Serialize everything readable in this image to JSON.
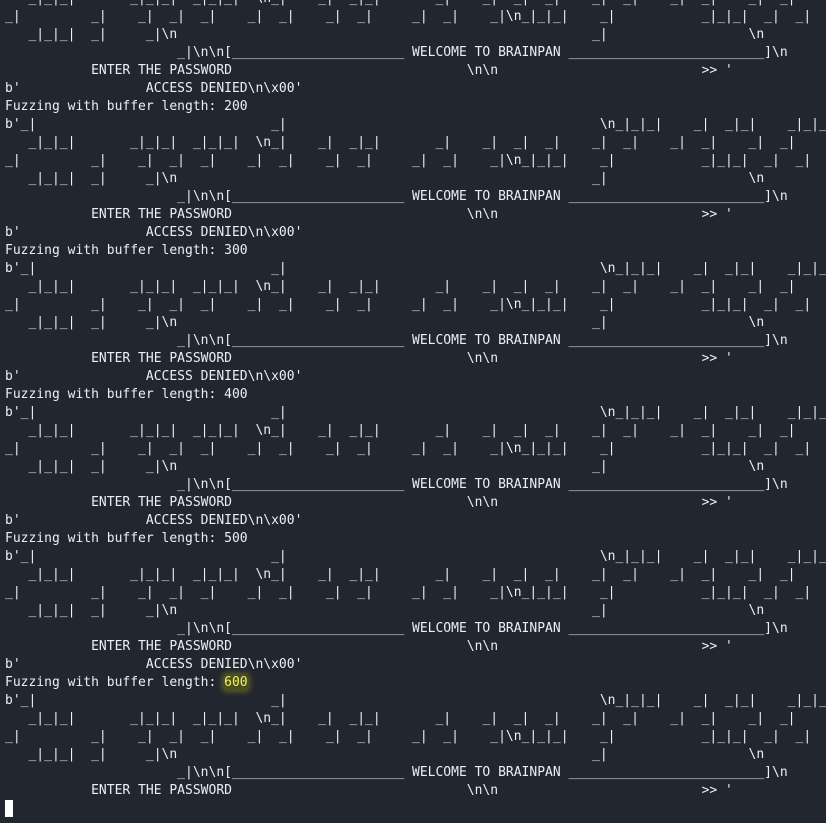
{
  "terminal": {
    "lines": [
      {
        "text": "   _|_|_|       _|_|_|  _|_|_|  \\n_|    _|  _|_|       _|    _|  _|  _|    _|  _|    _|  _|    _|  _|",
        "pre": "",
        "hl": "",
        "post": ""
      },
      {
        "text": "_|         _|    _|  _|  _|    _|  _|    _|  _|     _|  _|    _|\\n_|_|_|    _|           _|_|_|  _|  _|",
        "pre": "",
        "hl": "",
        "post": ""
      },
      {
        "text": "   _|_|_|  _|     _|\\n                                                     _|                  \\n",
        "pre": "",
        "hl": "",
        "post": ""
      },
      {
        "text": "                      _|\\n\\n[______________________ WELCOME TO BRAINPAN _________________________]\\n",
        "pre": "",
        "hl": "",
        "post": ""
      },
      {
        "text": "           ENTER THE PASSWORD                              \\n\\n                          >> '",
        "pre": "",
        "hl": "",
        "post": ""
      },
      {
        "text": "b'                ACCESS DENIED\\n\\x00'",
        "pre": "",
        "hl": "",
        "post": ""
      },
      {
        "text": "Fuzzing with buffer length: 200",
        "pre": "",
        "hl": "",
        "post": ""
      },
      {
        "text": "b'_|                              _|                                        \\n_|_|_|    _|  _|_|    _|_|_",
        "pre": "",
        "hl": "",
        "post": ""
      },
      {
        "text": "   _|_|_|       _|_|_|  _|_|_|  \\n_|    _|  _|_|       _|    _|  _|  _|    _|  _|    _|  _|    _|  _|",
        "pre": "",
        "hl": "",
        "post": ""
      },
      {
        "text": "_|         _|    _|  _|  _|    _|  _|    _|  _|     _|  _|    _|\\n_|_|_|    _|           _|_|_|  _|  _|",
        "pre": "",
        "hl": "",
        "post": ""
      },
      {
        "text": "   _|_|_|  _|     _|\\n                                                     _|                  \\n",
        "pre": "",
        "hl": "",
        "post": ""
      },
      {
        "text": "                      _|\\n\\n[______________________ WELCOME TO BRAINPAN _________________________]\\n",
        "pre": "",
        "hl": "",
        "post": ""
      },
      {
        "text": "           ENTER THE PASSWORD                              \\n\\n                          >> '",
        "pre": "",
        "hl": "",
        "post": ""
      },
      {
        "text": "b'                ACCESS DENIED\\n\\x00'",
        "pre": "",
        "hl": "",
        "post": ""
      },
      {
        "text": "Fuzzing with buffer length: 300",
        "pre": "",
        "hl": "",
        "post": ""
      },
      {
        "text": "b'_|                              _|                                        \\n_|_|_|    _|  _|_|    _|_|_",
        "pre": "",
        "hl": "",
        "post": ""
      },
      {
        "text": "   _|_|_|       _|_|_|  _|_|_|  \\n_|    _|  _|_|       _|    _|  _|  _|    _|  _|    _|  _|    _|  _|",
        "pre": "",
        "hl": "",
        "post": ""
      },
      {
        "text": "_|         _|    _|  _|  _|    _|  _|    _|  _|     _|  _|    _|\\n_|_|_|    _|           _|_|_|  _|  _|",
        "pre": "",
        "hl": "",
        "post": ""
      },
      {
        "text": "   _|_|_|  _|     _|\\n                                                     _|                  \\n",
        "pre": "",
        "hl": "",
        "post": ""
      },
      {
        "text": "                      _|\\n\\n[______________________ WELCOME TO BRAINPAN _________________________]\\n",
        "pre": "",
        "hl": "",
        "post": ""
      },
      {
        "text": "           ENTER THE PASSWORD                              \\n\\n                          >> '",
        "pre": "",
        "hl": "",
        "post": ""
      },
      {
        "text": "b'                ACCESS DENIED\\n\\x00'",
        "pre": "",
        "hl": "",
        "post": ""
      },
      {
        "text": "Fuzzing with buffer length: 400",
        "pre": "",
        "hl": "",
        "post": ""
      },
      {
        "text": "b'_|                              _|                                        \\n_|_|_|    _|  _|_|    _|_|_",
        "pre": "",
        "hl": "",
        "post": ""
      },
      {
        "text": "   _|_|_|       _|_|_|  _|_|_|  \\n_|    _|  _|_|       _|    _|  _|  _|    _|  _|    _|  _|    _|  _|",
        "pre": "",
        "hl": "",
        "post": ""
      },
      {
        "text": "_|         _|    _|  _|  _|    _|  _|    _|  _|     _|  _|    _|\\n_|_|_|    _|           _|_|_|  _|  _|",
        "pre": "",
        "hl": "",
        "post": ""
      },
      {
        "text": "   _|_|_|  _|     _|\\n                                                     _|                  \\n",
        "pre": "",
        "hl": "",
        "post": ""
      },
      {
        "text": "                      _|\\n\\n[______________________ WELCOME TO BRAINPAN _________________________]\\n",
        "pre": "",
        "hl": "",
        "post": ""
      },
      {
        "text": "           ENTER THE PASSWORD                              \\n\\n                          >> '",
        "pre": "",
        "hl": "",
        "post": ""
      },
      {
        "text": "b'                ACCESS DENIED\\n\\x00'",
        "pre": "",
        "hl": "",
        "post": ""
      },
      {
        "text": "Fuzzing with buffer length: 500",
        "pre": "",
        "hl": "",
        "post": ""
      },
      {
        "text": "b'_|                              _|                                        \\n_|_|_|    _|  _|_|    _|_|_",
        "pre": "",
        "hl": "",
        "post": ""
      },
      {
        "text": "   _|_|_|       _|_|_|  _|_|_|  \\n_|    _|  _|_|       _|    _|  _|  _|    _|  _|    _|  _|    _|  _|",
        "pre": "",
        "hl": "",
        "post": ""
      },
      {
        "text": "_|         _|    _|  _|  _|    _|  _|    _|  _|     _|  _|    _|\\n_|_|_|    _|           _|_|_|  _|  _|",
        "pre": "",
        "hl": "",
        "post": ""
      },
      {
        "text": "   _|_|_|  _|     _|\\n                                                     _|                  \\n",
        "pre": "",
        "hl": "",
        "post": ""
      },
      {
        "text": "                      _|\\n\\n[______________________ WELCOME TO BRAINPAN _________________________]\\n",
        "pre": "",
        "hl": "",
        "post": ""
      },
      {
        "text": "           ENTER THE PASSWORD                              \\n\\n                          >> '",
        "pre": "",
        "hl": "",
        "post": ""
      },
      {
        "text": "b'                ACCESS DENIED\\n\\x00'",
        "pre": "",
        "hl": "",
        "post": ""
      },
      {
        "text": "",
        "pre": "Fuzzing with buffer length: ",
        "hl": "600",
        "post": ""
      },
      {
        "text": "b'_|                              _|                                        \\n_|_|_|    _|  _|_|    _|_|_",
        "pre": "",
        "hl": "",
        "post": ""
      },
      {
        "text": "   _|_|_|       _|_|_|  _|_|_|  \\n_|    _|  _|_|       _|    _|  _|  _|    _|  _|    _|  _|    _|  _|",
        "pre": "",
        "hl": "",
        "post": ""
      },
      {
        "text": "_|         _|    _|  _|  _|    _|  _|    _|  _|     _|  _|    _|\\n_|_|_|    _|           _|_|_|  _|  _|",
        "pre": "",
        "hl": "",
        "post": ""
      },
      {
        "text": "   _|_|_|  _|     _|\\n                                                     _|                  \\n",
        "pre": "",
        "hl": "",
        "post": ""
      },
      {
        "text": "                      _|\\n\\n[______________________ WELCOME TO BRAINPAN _________________________]\\n",
        "pre": "",
        "hl": "",
        "post": ""
      },
      {
        "text": "           ENTER THE PASSWORD                              \\n\\n                          >> '",
        "pre": "",
        "hl": "",
        "post": ""
      }
    ]
  }
}
